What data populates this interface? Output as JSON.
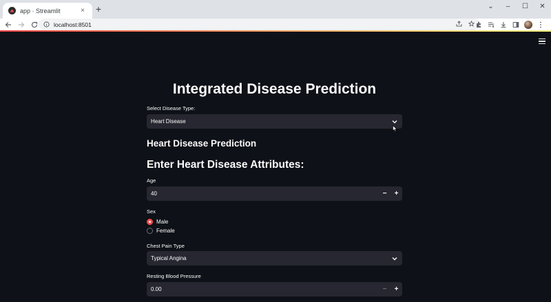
{
  "browser": {
    "tab_title": "app · Streamlit",
    "tab_close": "×",
    "new_tab": "+",
    "url": "localhost:8501",
    "window_controls": {
      "dropdown": "⌄",
      "minimize": "–",
      "maximize": "☐",
      "close": "✕"
    }
  },
  "app": {
    "title": "Integrated Disease Prediction",
    "disease_select": {
      "label": "Select Disease Type:",
      "value": "Heart Disease"
    },
    "subheader": "Heart Disease Prediction",
    "section_header": "Enter Heart Disease Attributes:",
    "age": {
      "label": "Age",
      "value": "40",
      "minus": "−",
      "plus": "+"
    },
    "sex": {
      "label": "Sex",
      "options": [
        "Male",
        "Female"
      ],
      "selected": "Male"
    },
    "chest_pain": {
      "label": "Chest Pain Type",
      "value": "Typical Angina"
    },
    "resting_bp": {
      "label": "Resting Blood Pressure",
      "value": "0.00",
      "minus": "−",
      "plus": "+"
    }
  },
  "colors": {
    "background": "#0e1117",
    "widget_bg": "#262730",
    "accent": "#ff4b4b",
    "text": "#fafafa"
  }
}
